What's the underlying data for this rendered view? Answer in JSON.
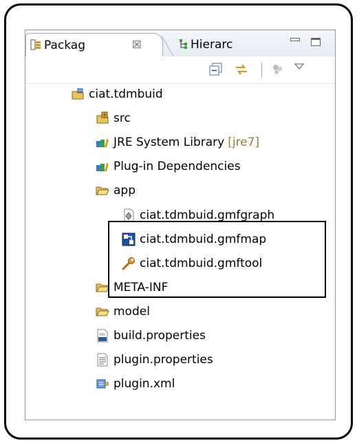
{
  "tabs": [
    {
      "label": "Packag",
      "active": true,
      "icon": "package-explorer-icon"
    },
    {
      "label": "Hierarc",
      "active": false,
      "icon": "hierarchy-icon"
    }
  ],
  "close_glyph": "☒",
  "toolbar": {
    "icons": [
      "collapse-all-icon",
      "link-with-editor-icon",
      "filter-icon",
      "view-menu-icon"
    ]
  },
  "tree": {
    "project": {
      "label": "ciat.tdmbuid",
      "icon": "plugin-project-icon"
    },
    "items": [
      {
        "label": "src",
        "icon": "source-folder-icon"
      },
      {
        "label": "JRE System Library",
        "decoration": "[jre7]",
        "icon": "library-icon"
      },
      {
        "label": "Plug-in Dependencies",
        "icon": "library-icon"
      },
      {
        "label": "app",
        "icon": "folder-open-icon"
      },
      {
        "label": "ciat.tdmbuid.gmfgraph",
        "icon": "gmfgraph-file-icon"
      },
      {
        "label": "ciat.tdmbuid.gmfmap",
        "icon": "gmfmap-file-icon"
      },
      {
        "label": "ciat.tdmbuid.gmftool",
        "icon": "gmftool-file-icon"
      },
      {
        "label": "META-INF",
        "icon": "folder-open-icon"
      },
      {
        "label": "model",
        "icon": "folder-open-icon"
      },
      {
        "label": "build.properties",
        "icon": "properties-file-icon"
      },
      {
        "label": "plugin.properties",
        "icon": "text-file-icon"
      },
      {
        "label": "plugin.xml",
        "icon": "plugin-xml-icon"
      }
    ]
  },
  "colors": {
    "decoration": "#9c7a3c",
    "folder": "#e8c25a",
    "panel_border": "#8f9aa6"
  }
}
